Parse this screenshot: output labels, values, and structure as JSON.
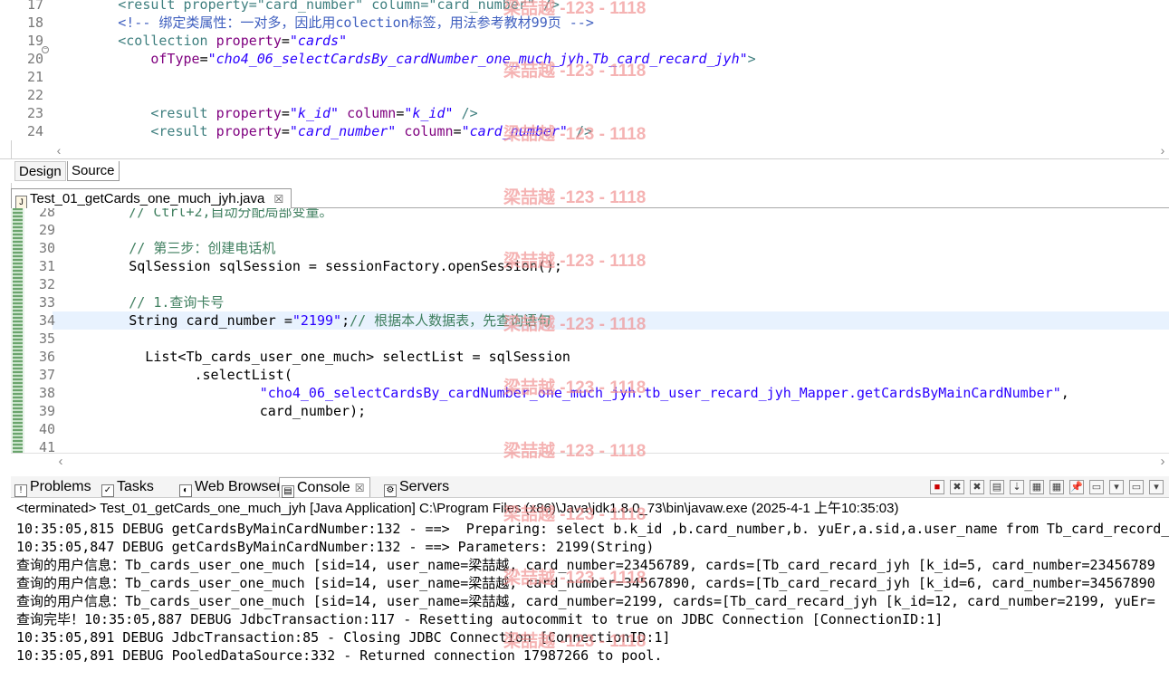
{
  "xml_editor": {
    "lines": [
      {
        "n": "17",
        "parts": [
          {
            "t": "        <result property=\"card_number\" column=\"card_number\" />",
            "c": "c-tag"
          }
        ]
      },
      {
        "n": "18",
        "parts": [
          {
            "t": "        <!-- 绑定类属性：一对多，因此用colection标签，用法参考教材99页 -->",
            "c": "c-comment"
          }
        ]
      },
      {
        "n": "19",
        "parts": [
          {
            "t": "        <collection ",
            "c": "c-tag"
          },
          {
            "t": "property",
            "c": "c-attr"
          },
          {
            "t": "=",
            "c": "c-plain"
          },
          {
            "t": "\"cards\"",
            "c": "c-val"
          }
        ]
      },
      {
        "n": "20",
        "parts": [
          {
            "t": "            ofType",
            "c": "c-attr"
          },
          {
            "t": "=",
            "c": "c-plain"
          },
          {
            "t": "\"cho4_06_selectCardsBy_cardNumber_one_much_jyh.Tb_card_recard_jyh\"",
            "c": "c-val"
          },
          {
            "t": ">",
            "c": "c-tag"
          }
        ]
      },
      {
        "n": "21",
        "parts": []
      },
      {
        "n": "22",
        "parts": []
      },
      {
        "n": "23",
        "parts": [
          {
            "t": "            <result ",
            "c": "c-tag"
          },
          {
            "t": "property",
            "c": "c-attr"
          },
          {
            "t": "=",
            "c": "c-plain"
          },
          {
            "t": "\"k_id\"",
            "c": "c-val"
          },
          {
            "t": " column",
            "c": "c-attr"
          },
          {
            "t": "=",
            "c": "c-plain"
          },
          {
            "t": "\"k_id\"",
            "c": "c-val"
          },
          {
            "t": " />",
            "c": "c-tag"
          }
        ]
      },
      {
        "n": "24",
        "parts": [
          {
            "t": "            <result ",
            "c": "c-tag"
          },
          {
            "t": "property",
            "c": "c-attr"
          },
          {
            "t": "=",
            "c": "c-plain"
          },
          {
            "t": "\"card_number\"",
            "c": "c-val"
          },
          {
            "t": " column",
            "c": "c-attr"
          },
          {
            "t": "=",
            "c": "c-plain"
          },
          {
            "t": "\"card_number\"",
            "c": "c-val"
          },
          {
            "t": " />",
            "c": "c-tag"
          }
        ]
      }
    ]
  },
  "mode_tabs": {
    "design": "Design",
    "source": "Source"
  },
  "java_tab": {
    "title": "Test_01_getCards_one_much_jyh.java",
    "close": "☒"
  },
  "java_editor": {
    "lines": [
      {
        "n": "28",
        "parts": [
          {
            "t": "        // Ctrl+2,自动分配局部变量。",
            "c": "j-comment"
          }
        ]
      },
      {
        "n": "29",
        "parts": []
      },
      {
        "n": "30",
        "parts": [
          {
            "t": "        // 第三步：创建电话机",
            "c": "j-comment"
          }
        ]
      },
      {
        "n": "31",
        "parts": [
          {
            "t": "        SqlSession sqlSession = sessionFactory.openSession();",
            "c": "c-plain"
          }
        ]
      },
      {
        "n": "32",
        "parts": []
      },
      {
        "n": "33",
        "parts": [
          {
            "t": "        // 1.查询卡号",
            "c": "j-comment"
          }
        ]
      },
      {
        "n": "34",
        "parts": [
          {
            "t": "        String card_number =",
            "c": "c-plain"
          },
          {
            "t": "\"2199\"",
            "c": "j-str"
          },
          {
            "t": ";",
            "c": "c-plain"
          },
          {
            "t": "// 根据本人数据表，先查询语句",
            "c": "j-comment"
          }
        ]
      },
      {
        "n": "35",
        "parts": []
      },
      {
        "n": "36",
        "parts": [
          {
            "t": "          List<Tb_cards_user_one_much> selectList = sqlSession",
            "c": "c-plain"
          }
        ]
      },
      {
        "n": "37",
        "parts": [
          {
            "t": "                .selectList(",
            "c": "c-plain"
          }
        ]
      },
      {
        "n": "38",
        "parts": [
          {
            "t": "                        ",
            "c": "c-plain"
          },
          {
            "t": "\"cho4_06_selectCardsBy_cardNumber_one_much_jyh.tb_user_recard_jyh_Mapper.getCardsByMainCardNumber\"",
            "c": "j-str"
          },
          {
            "t": ",",
            "c": "c-plain"
          }
        ]
      },
      {
        "n": "39",
        "parts": [
          {
            "t": "                        card_number);",
            "c": "c-plain"
          }
        ]
      },
      {
        "n": "40",
        "parts": []
      },
      {
        "n": "41",
        "parts": []
      }
    ]
  },
  "views": {
    "tabs": [
      {
        "label": "Problems",
        "icon": "!",
        "name": "problems"
      },
      {
        "label": "Tasks",
        "icon": "✓",
        "name": "tasks"
      },
      {
        "label": "Web Browser",
        "icon": "◐",
        "name": "web-browser"
      },
      {
        "label": "Console",
        "icon": "▤",
        "name": "console",
        "close": "☒"
      },
      {
        "label": "Servers",
        "icon": "⚙",
        "name": "servers"
      }
    ]
  },
  "console": {
    "header": "<terminated> Test_01_getCards_one_much_jyh [Java Application] C:\\Program Files (x86)\\Java\\jdk1.8.0_73\\bin\\javaw.exe (2025-4-1 上午10:35:03)",
    "lines": [
      "10:35:05,815 DEBUG getCardsByMainCardNumber:132 - ==>  Preparing: select b.k_id ,b.card_number,b. yuEr,a.sid,a.user_name from Tb_card_record_j",
      "10:35:05,847 DEBUG getCardsByMainCardNumber:132 - ==> Parameters: 2199(String)",
      "查询的用户信息：Tb_cards_user_one_much [sid=14, user_name=梁喆越, card_number=23456789, cards=[Tb_card_recard_jyh [k_id=5, card_number=23456789",
      "查询的用户信息：Tb_cards_user_one_much [sid=14, user_name=梁喆越, card_number=34567890, cards=[Tb_card_recard_jyh [k_id=6, card_number=34567890",
      "查询的用户信息：Tb_cards_user_one_much [sid=14, user_name=梁喆越, card_number=2199, cards=[Tb_card_recard_jyh [k_id=12, card_number=2199, yuEr=",
      "查询完毕！10:35:05,887 DEBUG JdbcTransaction:117 - Resetting autocommit to true on JDBC Connection [ConnectionID:1]",
      "10:35:05,891 DEBUG JdbcTransaction:85 - Closing JDBC Connection [ConnectionID:1]",
      "10:35:05,891 DEBUG PooledDataSource:332 - Returned connection 17987266 to pool."
    ]
  },
  "watermark": {
    "text": "梁喆越 -123 - 1118"
  },
  "colors": {
    "watermark": "#f08c8c",
    "highlight_line": "#e8f2fe",
    "gutter_stripe": "#6aa46c"
  }
}
